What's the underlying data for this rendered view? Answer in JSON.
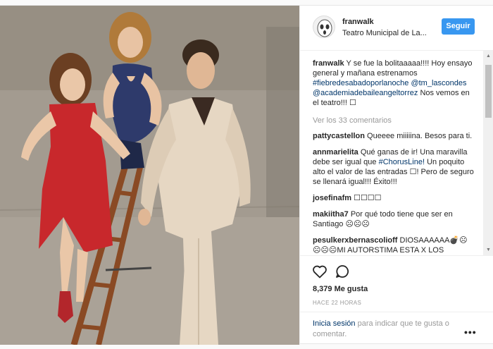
{
  "header": {
    "username": "franwalk",
    "location": "Teatro Municipal de La...",
    "follow_label": "Seguir"
  },
  "caption": {
    "username": "franwalk",
    "text_1": "Y se fue la bolitaaaaa!!!! Hoy ensayo general y mañana estrenamos",
    "hashtag": "#fiebredesabadoporlanoche",
    "mention_1": "@tm_lascondes",
    "mention_2": "@academiadebaileangeltorrez",
    "text_2": "Nos vemos en el teatro!!! ☐"
  },
  "view_comments": "Ver los 33 comentarios",
  "comments": [
    {
      "user": "pattycastellon",
      "text_1": "Queeee miiiiina. Besos para ti.",
      "link": "",
      "text_2": ""
    },
    {
      "user": "annmarielita",
      "text_1": "Qué ganas de ir! Una maravilla debe ser igual que",
      "link": "#ChorusLine!",
      "text_2": "Un poquito alto el valor de las entradas ☐! Pero de seguro se llenará igual!!! Éxito!!!"
    },
    {
      "user": "josefinafm",
      "text_1": "☐☐☐☐",
      "link": "",
      "text_2": ""
    },
    {
      "user": "makiitha7",
      "text_1": "Por qué todo tiene que ser en Santiago ☹☹☹",
      "link": "",
      "text_2": ""
    },
    {
      "user": "pesulkerxbernascolioff",
      "text_1": "DIOSAAAAAA💣☹ ☹☹☹MI AUTORSTIMA ESTA X LOS",
      "link": "",
      "text_2": ""
    }
  ],
  "actions": {
    "like_icon": "heart-icon",
    "comment_icon": "comment-icon",
    "likes": "8,379 Me gusta",
    "time": "HACE 22 HORAS"
  },
  "login": {
    "link": "Inicia sesión",
    "text": "para indicar que te gusta o comentar.",
    "more_icon": "more-options-icon"
  },
  "colors": {
    "accent": "#3897f0",
    "link": "#003569",
    "muted": "#999999",
    "dress": "#c8282c",
    "leotard": "#2e3a6b",
    "suit": "#e6d7c3"
  }
}
